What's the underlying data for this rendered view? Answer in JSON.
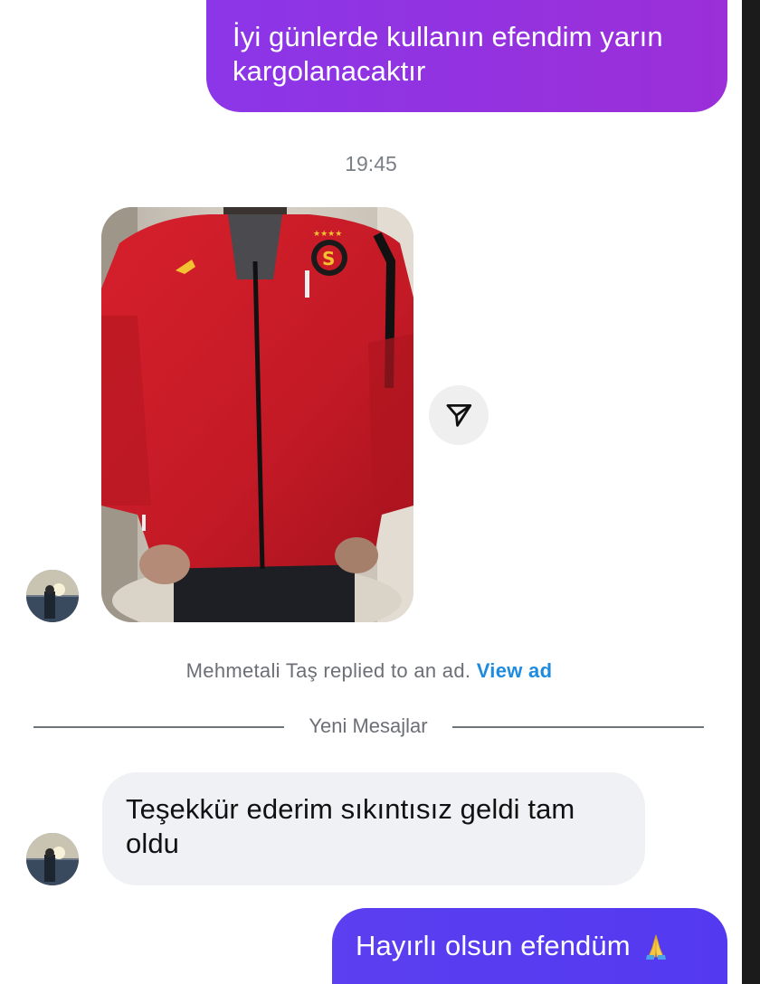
{
  "thread": {
    "outgoing_message_1": "İyi günlerde kullanın efendim yarın kargolanacaktır",
    "timestamp": "19:45",
    "ad_reply": {
      "text": "Mehmetali Taş replied to an ad.",
      "link_label": "View ad"
    },
    "divider_label": "Yeni Mesajlar",
    "incoming_message": "Teşekkür ederim sıkıntısız geldi tam oldu",
    "outgoing_message_2": "Hayırlı olsun efendüm",
    "outgoing_message_2_emoji": "praying-hands-emoji"
  },
  "icons": {
    "share": "paper-plane-icon",
    "avatar": "user-avatar"
  },
  "colors": {
    "outgoing_bubble_1": "#8b36e8",
    "outgoing_bubble_2": "#5b3ff0",
    "incoming_bubble": "#eff1f4",
    "link": "#1d8be0",
    "meta_text": "#6c6f75"
  }
}
